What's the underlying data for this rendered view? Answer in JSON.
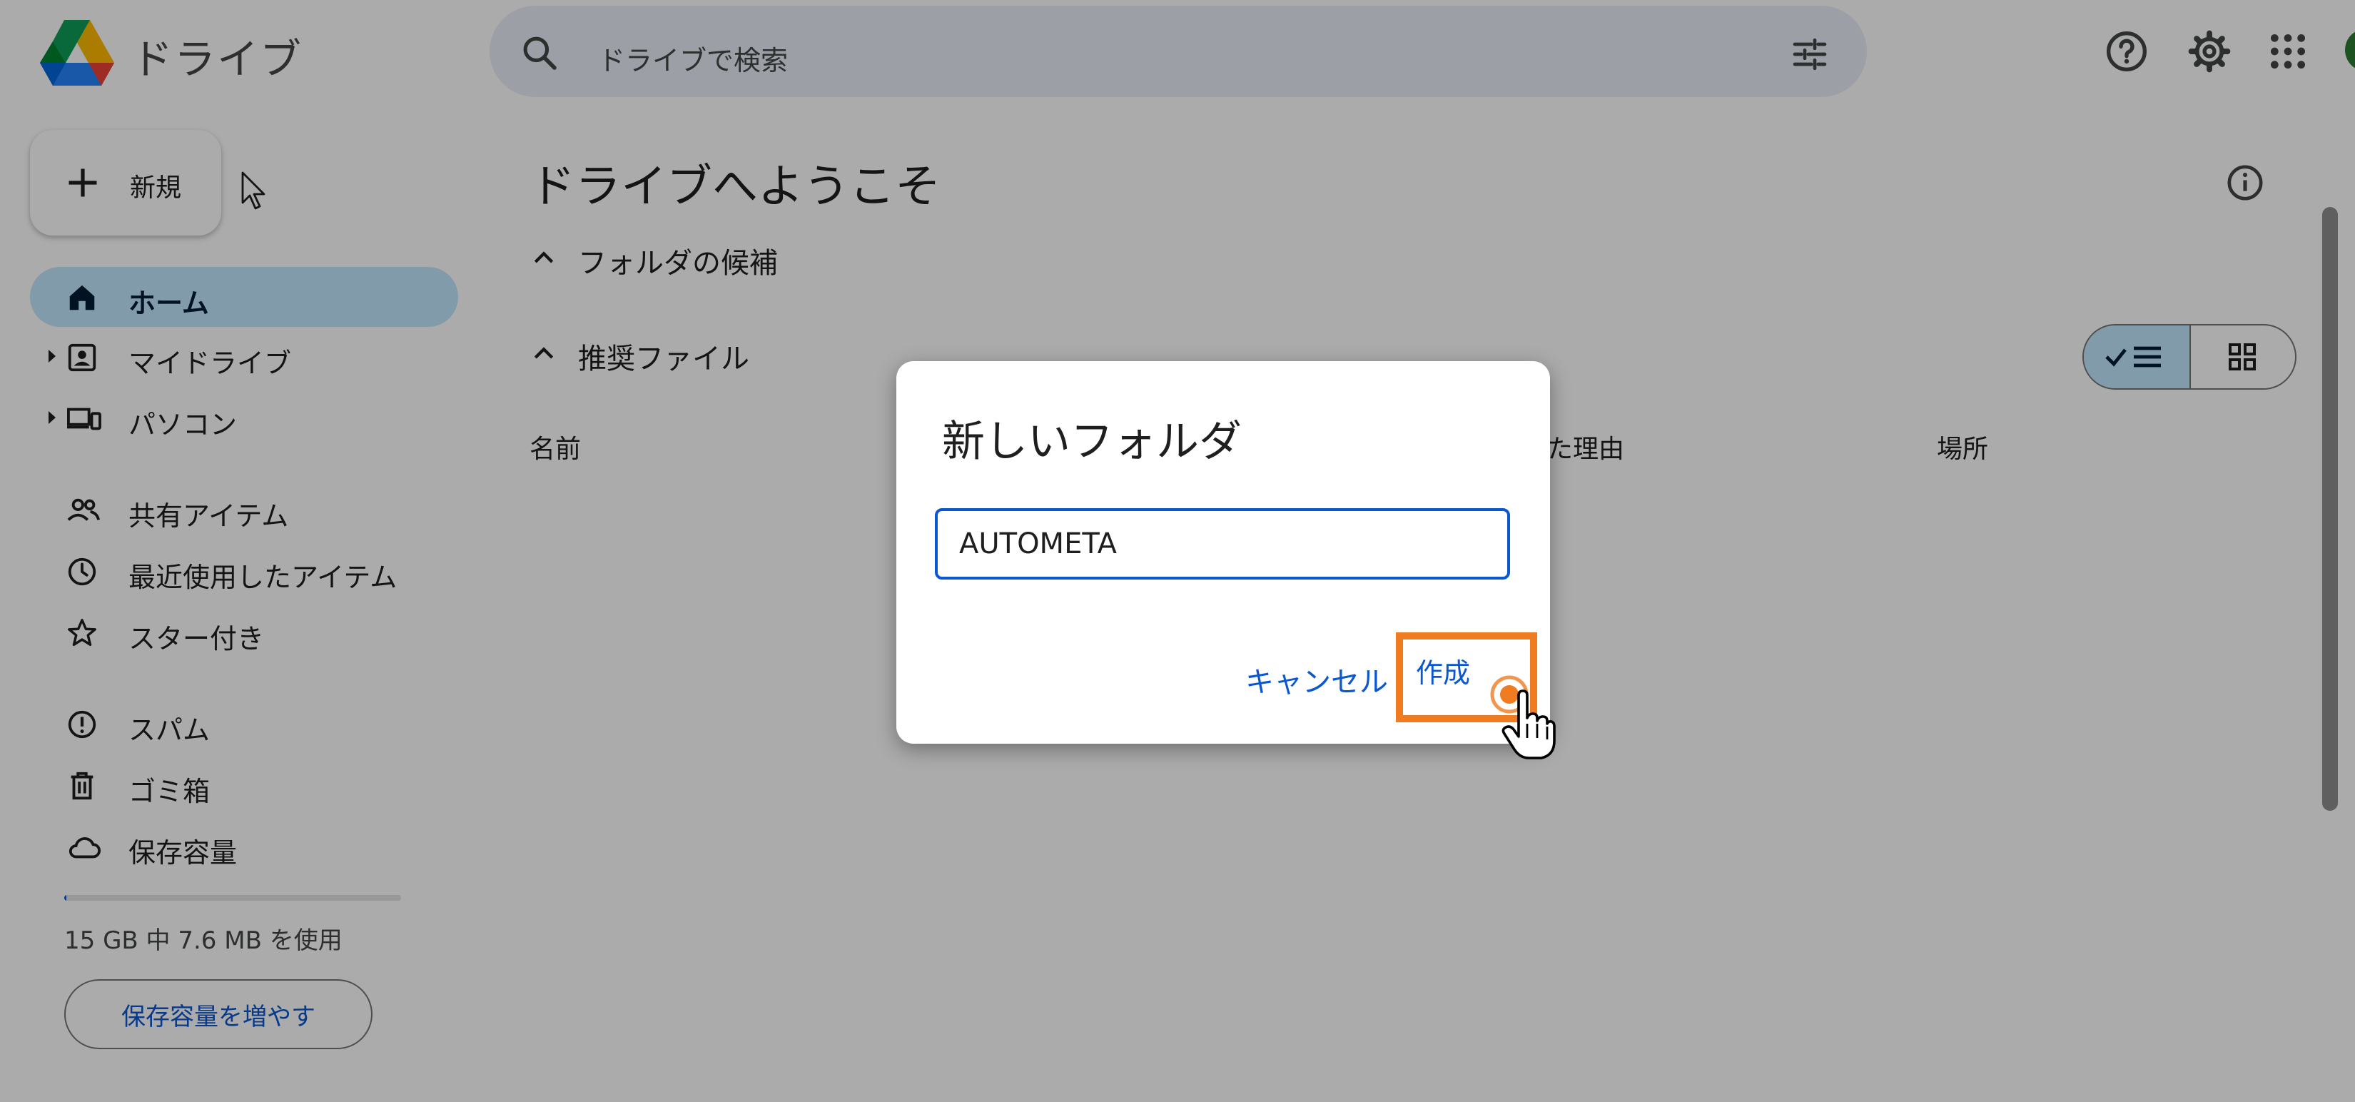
{
  "header": {
    "app_title": "ドライブ",
    "search_placeholder": "ドライブで検索"
  },
  "sidebar": {
    "new_label": "新規",
    "items": [
      {
        "label": "ホーム",
        "icon": "home-icon",
        "active": true
      },
      {
        "label": "マイドライブ",
        "icon": "my-drive-icon",
        "expandable": true
      },
      {
        "label": "パソコン",
        "icon": "computers-icon",
        "expandable": true
      },
      {
        "label": "共有アイテム",
        "icon": "shared-icon"
      },
      {
        "label": "最近使用したアイテム",
        "icon": "clock-icon"
      },
      {
        "label": "スター付き",
        "icon": "star-icon"
      },
      {
        "label": "スパム",
        "icon": "spam-icon"
      },
      {
        "label": "ゴミ箱",
        "icon": "trash-icon"
      },
      {
        "label": "保存容量",
        "icon": "cloud-icon"
      }
    ],
    "storage_text": "15 GB 中 7.6 MB を使用",
    "storage_used_fraction": 0.0005,
    "storage_button_label": "保存容量を増やす"
  },
  "main": {
    "title": "ドライブへようこそ",
    "sections": [
      "フォルダの候補",
      "推奨ファイル"
    ],
    "columns": [
      "名前",
      "た理由",
      "場所"
    ]
  },
  "dialog": {
    "title": "新しいフォルダ",
    "input_value": "AUTOMETA",
    "cancel_label": "キャンセル",
    "create_label": "作成"
  },
  "colors": {
    "accent": "#0b57d0",
    "highlight": "#f07c21",
    "active_nav": "#c2e7ff"
  }
}
